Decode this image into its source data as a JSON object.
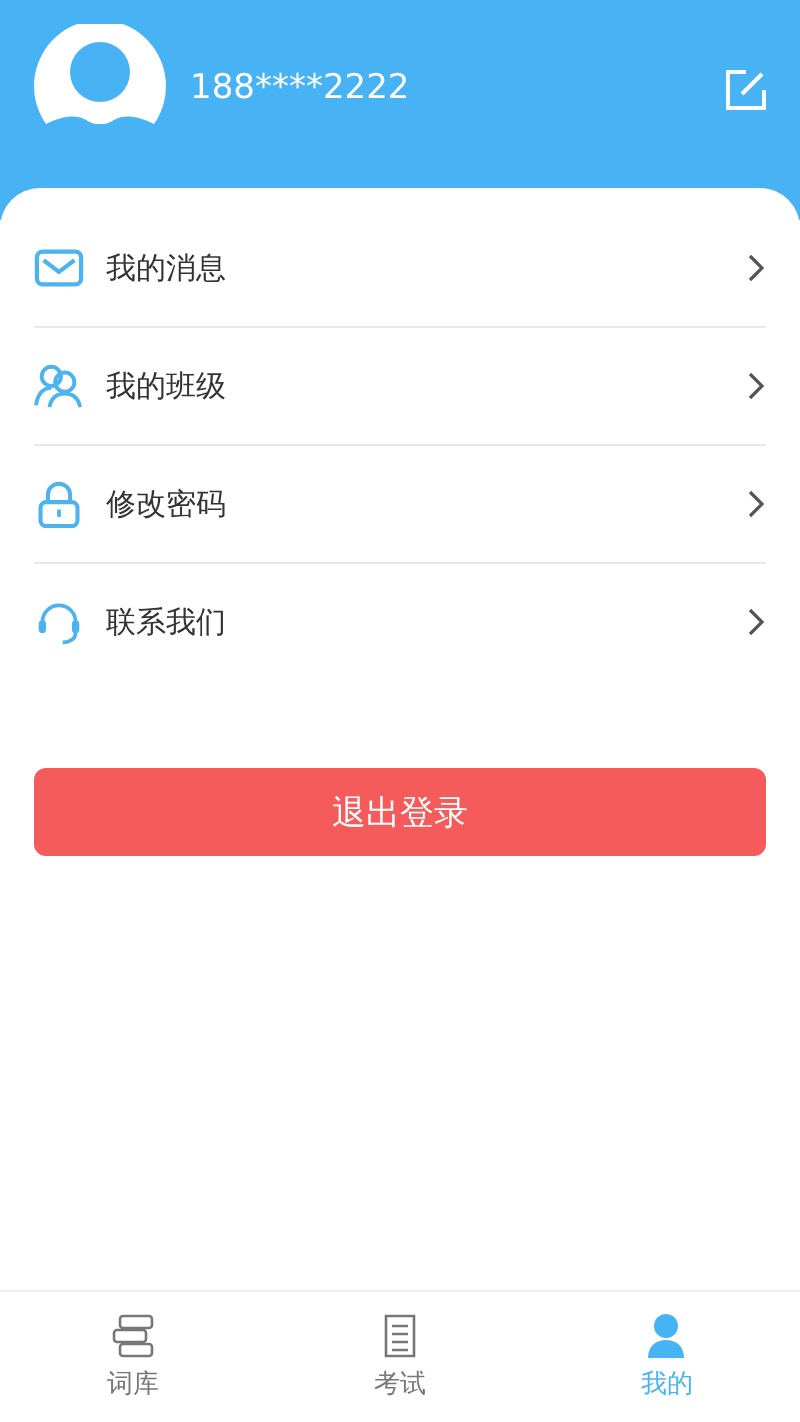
{
  "header": {
    "phone": "188****2222"
  },
  "menu": [
    {
      "kind": "mail",
      "label": "我的消息"
    },
    {
      "kind": "class",
      "label": "我的班级"
    },
    {
      "kind": "lock",
      "label": "修改密码"
    },
    {
      "kind": "contact",
      "label": "联系我们"
    }
  ],
  "logout_button": "退出登录",
  "tabs": [
    {
      "kind": "words",
      "label": "词库",
      "selected": false
    },
    {
      "kind": "exam",
      "label": "考试",
      "selected": false
    },
    {
      "kind": "me",
      "label": "我的",
      "selected": true
    }
  ]
}
